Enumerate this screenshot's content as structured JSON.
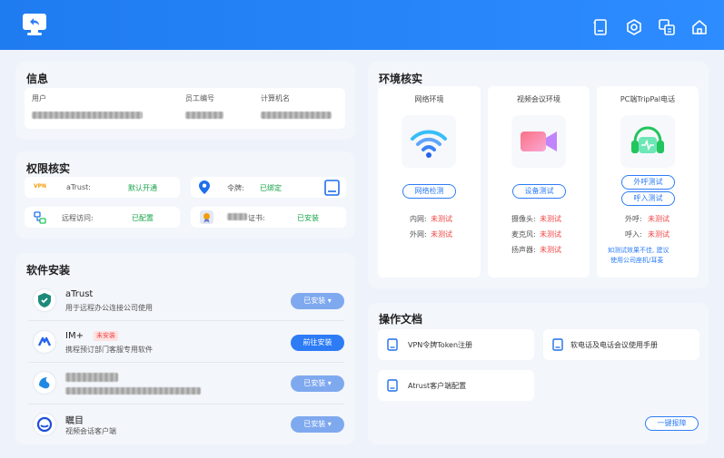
{
  "info": {
    "title": "信息",
    "user_label": "用户",
    "employee_id_label": "员工编号",
    "computer_label": "计算机名"
  },
  "permission": {
    "title": "权限核实",
    "vpn_tag": "VPN",
    "atrust_label": "aTrust:",
    "atrust_status": "默认开通",
    "token_label": "令牌:",
    "token_status": "已绑定",
    "remote_label": "远程访问:",
    "remote_status": "已配置",
    "cert_label": "证书:",
    "cert_status": "已安装"
  },
  "software": {
    "title": "软件安装",
    "items": [
      {
        "name": "aTrust",
        "desc": "用于远程办公连接公司使用",
        "button": "已安装",
        "badge": ""
      },
      {
        "name": "IM+",
        "desc": "携程预订部门客服专用软件",
        "button": "前往安装",
        "badge": "未安装"
      },
      {
        "name": "",
        "desc": "",
        "button": "已安装",
        "badge": ""
      },
      {
        "name": "瞩目",
        "desc": "视频会话客户端",
        "button": "已安装",
        "badge": ""
      }
    ],
    "dropdown_glyph": "▾"
  },
  "environment": {
    "title": "环境核实",
    "network": {
      "title": "网络环境",
      "button": "网络检测",
      "rows": [
        {
          "label": "内网:",
          "value": "未测试"
        },
        {
          "label": "外网:",
          "value": "未测试"
        }
      ]
    },
    "video": {
      "title": "视频会议环境",
      "button": "设备测试",
      "rows": [
        {
          "label": "摄像头:",
          "value": "未测试"
        },
        {
          "label": "麦克风:",
          "value": "未测试"
        },
        {
          "label": "扬声器:",
          "value": "未测试"
        }
      ]
    },
    "phone": {
      "title": "PC端TripPal电话",
      "button_out": "外呼测试",
      "button_in": "呼入测试",
      "rows": [
        {
          "label": "外呼:",
          "value": "未测试"
        },
        {
          "label": "呼入:",
          "value": "未测试"
        }
      ],
      "note_line1": "如测试效果不佳, 建议",
      "note_line2": "使用公司座机/耳麦"
    }
  },
  "docs": {
    "title": "操作文档",
    "items": [
      "VPN令牌Token注册",
      "软电话及电话会议使用手册",
      "Atrust客户端配置"
    ],
    "report_button": "一键报障"
  }
}
